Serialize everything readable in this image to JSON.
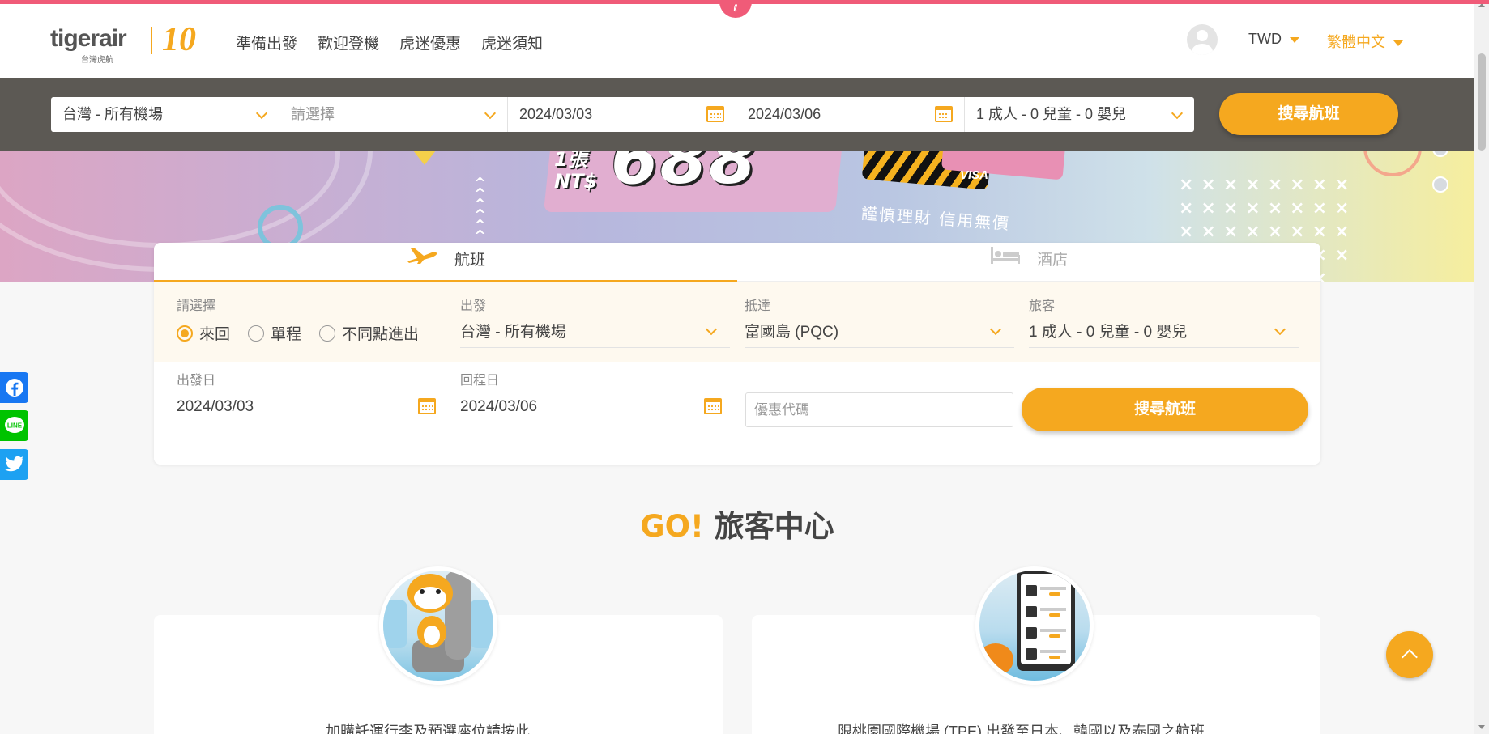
{
  "header": {
    "brand": "tigerair",
    "brand_sub": "台灣虎航",
    "anniversary": "10",
    "nav": [
      "準備出發",
      "歡迎登機",
      "虎迷優惠",
      "虎迷須知"
    ],
    "currency": "TWD",
    "language": "繁體中文"
  },
  "search_bar": {
    "origin": "台灣 - 所有機場",
    "destination_placeholder": "請選擇",
    "depart_date": "2024/03/03",
    "return_date": "2024/03/06",
    "passengers": "1 成人 - 0 兒童 - 0 嬰兒",
    "search_label": "搜尋航班"
  },
  "banner": {
    "promo_small_1": "1張",
    "promo_small_2": "NT$",
    "promo_big": "688",
    "card_brand": "VISA",
    "tagline": "謹慎理財 信用無價"
  },
  "booking": {
    "tabs": [
      "航班",
      "酒店"
    ],
    "trip_type_label": "請選擇",
    "trip_types": [
      "來回",
      "單程",
      "不同點進出"
    ],
    "selected_trip_type": "來回",
    "depart_label": "出發",
    "depart_value": "台灣 - 所有機場",
    "arrive_label": "抵達",
    "arrive_value": "富國島 (PQC)",
    "pax_label": "旅客",
    "pax_value": "1 成人 - 0 兒童 - 0 嬰兒",
    "depart_date_label": "出發日",
    "depart_date_value": "2024/03/03",
    "return_date_label": "回程日",
    "return_date_value": "2024/03/06",
    "promo_placeholder": "優惠代碼",
    "search_label": "搜尋航班"
  },
  "travel_center": {
    "title_go": "GO!",
    "title_rest": " 旅客中心",
    "cards": [
      {
        "text": "加購託運行李及預選座位請按此"
      },
      {
        "text": "限桃園國際機場 (TPE) 出發至日本、韓國以及泰國之航班"
      }
    ]
  },
  "social": [
    "facebook",
    "line",
    "twitter"
  ],
  "colors": {
    "accent": "#f5a81f",
    "top_bar": "#f05b78",
    "strip": "#5c5954"
  }
}
